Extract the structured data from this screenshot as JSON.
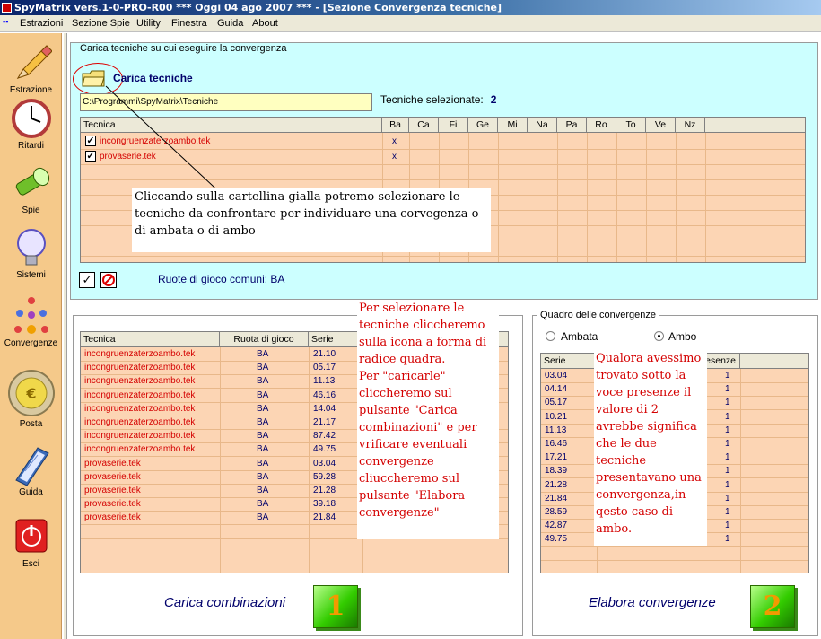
{
  "window": {
    "title": "SpyMatrix vers.1-0-PRO-R00  ***  Oggi 04 ago 2007  ***   - [Sezione Convergenza tecniche]"
  },
  "menu": [
    "Estrazioni",
    "Sezione Spie",
    "Utility",
    "Finestra",
    "Guida",
    "About"
  ],
  "sidebar": [
    {
      "label": "Estrazione",
      "icon": "pencil-icon"
    },
    {
      "label": "Ritardi",
      "icon": "clock-icon"
    },
    {
      "label": "Spie",
      "icon": "flashlight-icon"
    },
    {
      "label": "Sistemi",
      "icon": "lightbulb-icon"
    },
    {
      "label": "Convergenze",
      "icon": "convergence-icon"
    },
    {
      "label": "Posta",
      "icon": "euro-coin-icon"
    },
    {
      "label": "Guida",
      "icon": "book-icon"
    },
    {
      "label": "Esci",
      "icon": "power-icon"
    }
  ],
  "top_panel": {
    "legend": "Carica tecniche su cui eseguire la convergenza",
    "load_label": "Carica tecniche",
    "path": "C:\\Programmi\\SpyMatrix\\Tecniche",
    "selected_label": "Tecniche selezionate:",
    "selected_count": "2",
    "columns": [
      "Tecnica",
      "Ba",
      "Ca",
      "Fi",
      "Ge",
      "Mi",
      "Na",
      "Pa",
      "Ro",
      "To",
      "Ve",
      "Nz"
    ],
    "rows": [
      {
        "name": "incongruenzaterzoambo.tek",
        "ba": "x"
      },
      {
        "name": "provaserie.tek",
        "ba": "x"
      }
    ],
    "ruote_label": "Ruote di gioco comuni: BA"
  },
  "note1": "Cliccando sulla cartellina gialla potremo selezionare le tecniche da confrontare per individuare una corvegenza o di ambata o di ambo",
  "note2": "Per selezionare le tecniche cliccheremo sulla icona a forma di radice quadra.\nPer \"caricarle\" cliccheremo sul pulsante \"Carica combinazioni\" e per vrificare eventuali convergenze cliuccheremo sul pulsante \"Elabora convergenze\"",
  "note3": "Qualora avessimo trovato sotto la voce presenze il valore di 2 avrebbe significa che le due tecniche presentavano una convergenza,in qesto caso di ambo.",
  "combinations": {
    "columns": [
      "Tecnica",
      "Ruota di gioco",
      "Serie"
    ],
    "rows": [
      [
        "incongruenzaterzoambo.tek",
        "BA",
        "21.10"
      ],
      [
        "incongruenzaterzoambo.tek",
        "BA",
        "05.17"
      ],
      [
        "incongruenzaterzoambo.tek",
        "BA",
        "11.13"
      ],
      [
        "incongruenzaterzoambo.tek",
        "BA",
        "46.16"
      ],
      [
        "incongruenzaterzoambo.tek",
        "BA",
        "14.04"
      ],
      [
        "incongruenzaterzoambo.tek",
        "BA",
        "21.17"
      ],
      [
        "incongruenzaterzoambo.tek",
        "BA",
        "87.42"
      ],
      [
        "incongruenzaterzoambo.tek",
        "BA",
        "49.75"
      ],
      [
        "provaserie.tek",
        "BA",
        "03.04"
      ],
      [
        "provaserie.tek",
        "BA",
        "59.28"
      ],
      [
        "provaserie.tek",
        "BA",
        "21.28"
      ],
      [
        "provaserie.tek",
        "BA",
        "39.18"
      ],
      [
        "provaserie.tek",
        "BA",
        "21.84"
      ]
    ],
    "button_label": "Carica combinazioni",
    "button_number": "1"
  },
  "convergences": {
    "legend": "Quadro delle convergenze",
    "radio_ambata": "Ambata",
    "radio_ambo": "Ambo",
    "selected": "Ambo",
    "columns": [
      "Serie",
      "esenze"
    ],
    "rows": [
      [
        "03.04",
        "1"
      ],
      [
        "04.14",
        "1"
      ],
      [
        "05.17",
        "1"
      ],
      [
        "10.21",
        "1"
      ],
      [
        "11.13",
        "1"
      ],
      [
        "16.46",
        "1"
      ],
      [
        "17.21",
        "1"
      ],
      [
        "18.39",
        "1"
      ],
      [
        "21.28",
        "1"
      ],
      [
        "21.84",
        "1"
      ],
      [
        "28.59",
        "1"
      ],
      [
        "42.87",
        "1"
      ],
      [
        "49.75",
        "1"
      ]
    ],
    "button_label": "Elabora convergenze",
    "button_number": "2"
  }
}
